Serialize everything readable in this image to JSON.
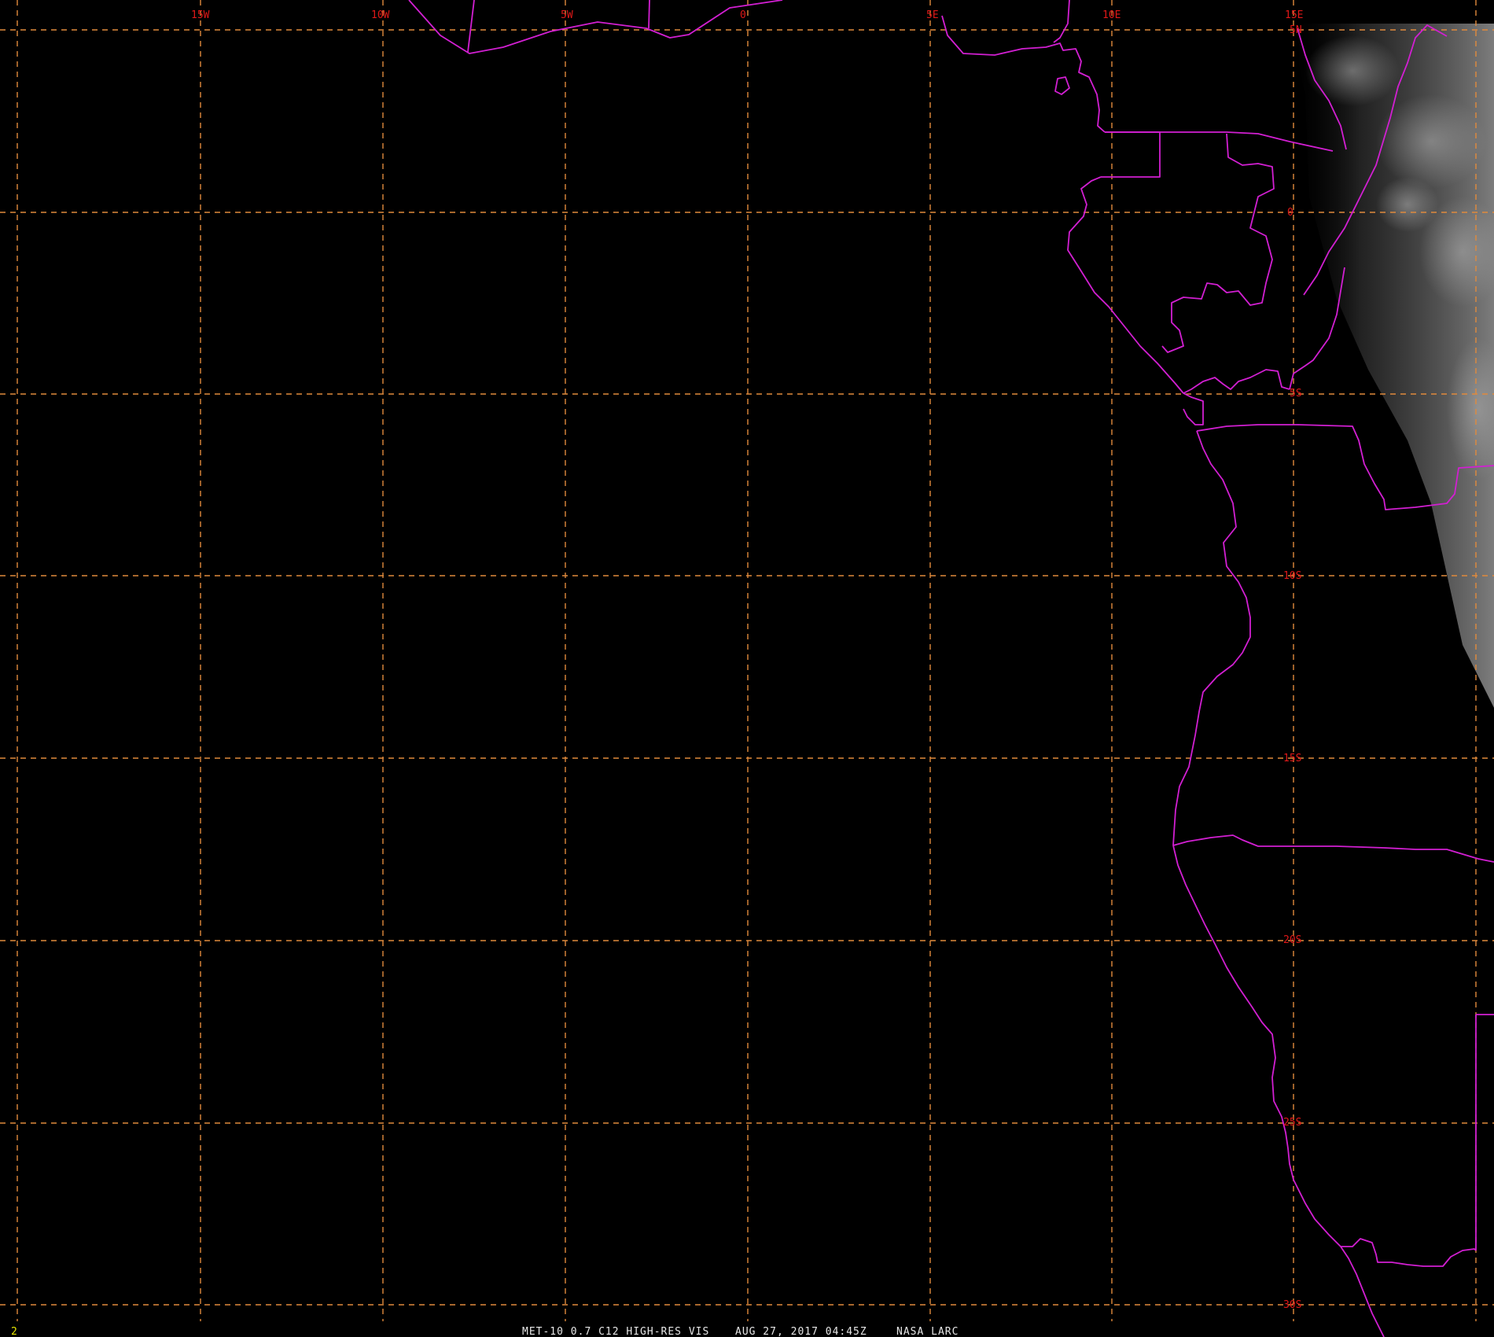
{
  "map": {
    "background": "#000000",
    "grid_color": "#e08a3c",
    "coastline_color": "#d21fd2",
    "label_color": "#e01818",
    "frame_number": "2",
    "caption": {
      "satellite_product": "MET-10 0.7 C12 HIGH-RES VIS",
      "datetime": "AUG 27, 2017 04:45Z",
      "source": "NASA LARC"
    },
    "longitude_labels": [
      "15W",
      "10W",
      "5W",
      "0",
      "5E",
      "10E",
      "15E"
    ],
    "latitude_labels": [
      "5N",
      "0",
      "5S",
      "10S",
      "15S",
      "20S",
      "25S",
      "30S"
    ]
  }
}
